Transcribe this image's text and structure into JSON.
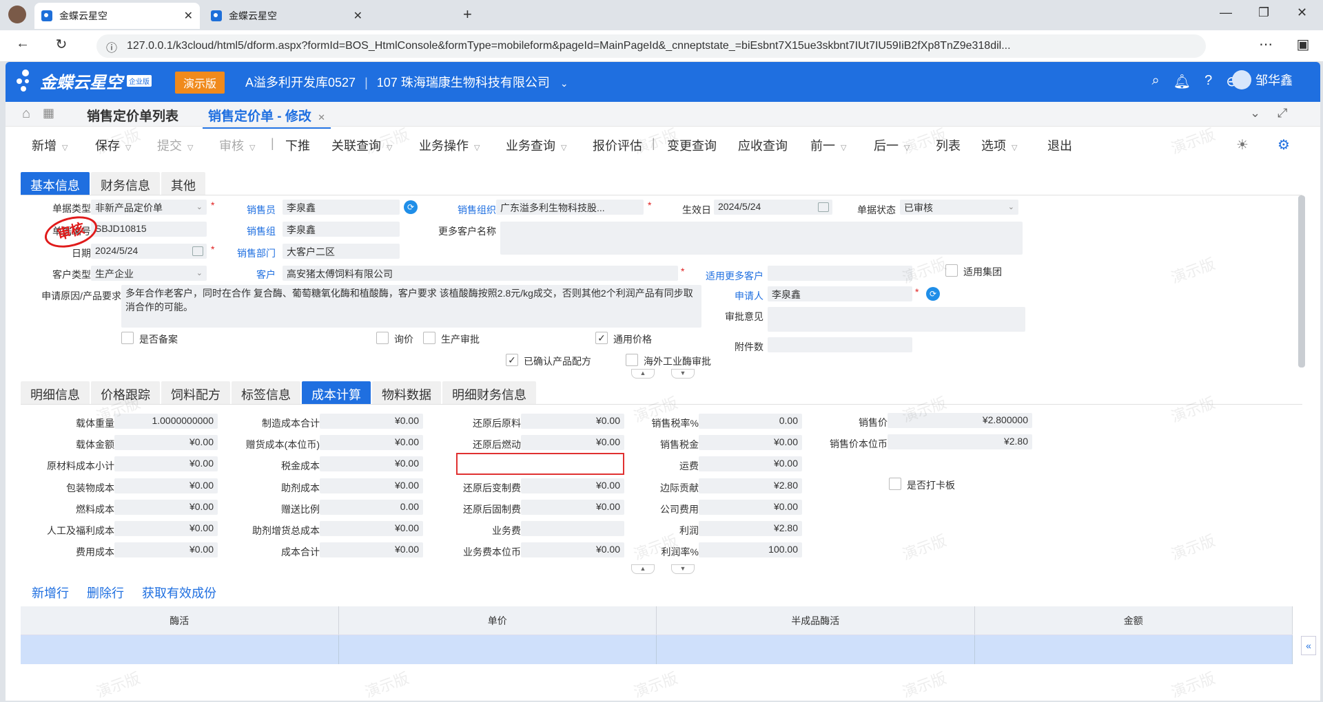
{
  "browser": {
    "tabs": [
      {
        "title": "金蝶云星空"
      },
      {
        "title": "金蝶云星空"
      }
    ],
    "url": "127.0.0.1/k3cloud/html5/dform.aspx?formId=BOS_HtmlConsole&formType=mobileform&pageId=MainPageId&_cnneptstate_=biEsbnt7X15ue3skbnt7IUt7IU59IiB2fXp8TnZ9e318dil..."
  },
  "app": {
    "logo": "金蝶云星空",
    "edition": "企业版",
    "demo_badge": "演示版",
    "datacenter": "A溢多利开发库0527",
    "company": "107 珠海瑞康生物科技有限公司",
    "user": "邹华鑫"
  },
  "pagetabs": {
    "list": "销售定价单列表",
    "current": "销售定价单 - 修改"
  },
  "toolbar": {
    "new": "新增",
    "save": "保存",
    "submit": "提交",
    "audit": "审核",
    "push": "下推",
    "link_query": "关联查询",
    "biz_op": "业务操作",
    "biz_query": "业务查询",
    "quote_eval": "报价评估",
    "change_query": "变更查询",
    "ar_query": "应收查询",
    "prev": "前一",
    "next": "后一",
    "list": "列表",
    "options": "选项",
    "exit": "退出"
  },
  "header_tabs": [
    "基本信息",
    "财务信息",
    "其他"
  ],
  "basic": {
    "doc_type_label": "单据类型",
    "doc_type": "非新产品定价单",
    "doc_no_label": "单据编号",
    "doc_no": "SBJD10815",
    "date_label": "日期",
    "date": "2024/5/24",
    "cust_type_label": "客户类型",
    "cust_type": "生产企业",
    "reason_label": "申请原因/产品要求",
    "reason": "多年合作老客户，同时在合作 复合酶、葡萄糖氧化酶和植酸酶，客户要求 该植酸酶按照2.8元/kg成交，否则其他2个利润产品有同步取消合作的可能。",
    "salesman_label": "销售员",
    "salesman": "李泉鑫",
    "salesgroup_label": "销售组",
    "salesgroup": "李泉鑫",
    "salesdept_label": "销售部门",
    "salesdept": "大客户二区",
    "customer_label": "客户",
    "customer": "高安猪太傅饲料有限公司",
    "salesorg_label": "销售组织",
    "salesorg": "广东溢多利生物科技股...",
    "more_cust_label": "更多客户名称",
    "effdate_label": "生效日",
    "effdate": "2024/5/24",
    "status_label": "单据状态",
    "status": "已审核",
    "more_applicable_label": "适用更多客户",
    "group_label": "适用集团",
    "applicant_label": "申请人",
    "applicant": "李泉鑫",
    "opinion_label": "审批意见",
    "attach_label": "附件数",
    "filed_label": "是否备案",
    "inquiry_label": "询价",
    "prod_approve_label": "生产审批",
    "general_price_label": "通用价格",
    "confirmed_formula_label": "已确认产品配方",
    "overseas_label": "海外工业酶审批",
    "stamp": "审核"
  },
  "detail_tabs": [
    "明细信息",
    "价格跟踪",
    "饲料配方",
    "标签信息",
    "成本计算",
    "物料数据",
    "明细财务信息"
  ],
  "cost": {
    "col1": [
      [
        "载体重量",
        "1.0000000000"
      ],
      [
        "载体金额",
        "¥0.00"
      ],
      [
        "原材料成本小计",
        "¥0.00"
      ],
      [
        "包装物成本",
        "¥0.00"
      ],
      [
        "燃料成本",
        "¥0.00"
      ],
      [
        "人工及福利成本",
        "¥0.00"
      ],
      [
        "费用成本",
        "¥0.00"
      ]
    ],
    "col2": [
      [
        "制造成本合计",
        "¥0.00"
      ],
      [
        "赠货成本(本位币)",
        "¥0.00"
      ],
      [
        "税金成本",
        "¥0.00"
      ],
      [
        "助剂成本",
        "¥0.00"
      ],
      [
        "赠送比例",
        "0.00"
      ],
      [
        "助剂增货总成本",
        "¥0.00"
      ],
      [
        "成本合计",
        "¥0.00"
      ]
    ],
    "col3": [
      [
        "还原后原料",
        "¥0.00"
      ],
      [
        "还原后燃动",
        "¥0.00"
      ],
      [
        "",
        ""
      ],
      [
        "还原后变制费",
        "¥0.00"
      ],
      [
        "还原后固制费",
        "¥0.00"
      ],
      [
        "业务费",
        ""
      ],
      [
        "业务费本位币",
        "¥0.00"
      ]
    ],
    "col4": [
      [
        "销售税率%",
        "0.00"
      ],
      [
        "销售税金",
        "¥0.00"
      ],
      [
        "运费",
        "¥0.00"
      ],
      [
        "边际贡献",
        "¥2.80"
      ],
      [
        "公司费用",
        "¥0.00"
      ],
      [
        "利润",
        "¥2.80"
      ],
      [
        "利润率%",
        "100.00"
      ]
    ],
    "sale_price_label": "销售价",
    "sale_price": "¥2.800000",
    "sale_price_base_label": "销售价本位币",
    "sale_price_base": "¥2.80",
    "punch_label": "是否打卡板"
  },
  "entry_actions": {
    "add": "新增行",
    "delete": "删除行",
    "fetch": "获取有效成份"
  },
  "grid_headers": [
    "酶活",
    "单价",
    "半成品酶活",
    "金额"
  ],
  "watermark": "演示版"
}
